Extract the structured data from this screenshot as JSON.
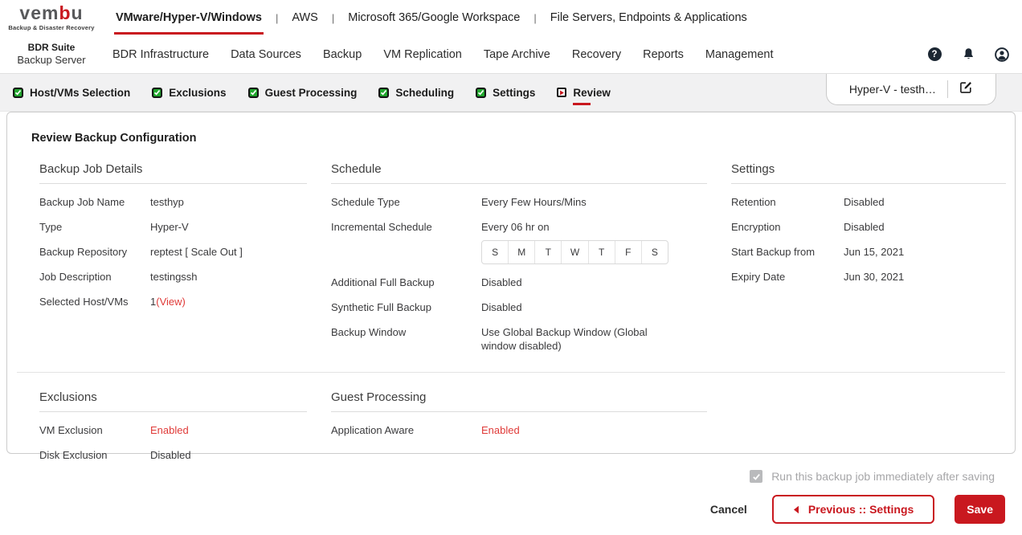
{
  "colors": {
    "brand_red": "#c9181f",
    "status_red": "#e03a38",
    "check_green": "#21a72e"
  },
  "logo": {
    "text_pre": "vem",
    "text_accent": "b",
    "text_post": "u",
    "tagline": "Backup & Disaster Recovery"
  },
  "product": {
    "suite": "BDR Suite",
    "server": "Backup Server"
  },
  "top_nav": {
    "items": [
      {
        "label": "VMware/Hyper-V/Windows",
        "active": true
      },
      {
        "label": "AWS"
      },
      {
        "label": "Microsoft 365/Google Workspace"
      },
      {
        "label": "File Servers, Endpoints & Applications"
      }
    ]
  },
  "main_nav": {
    "items": [
      "BDR Infrastructure",
      "Data Sources",
      "Backup",
      "VM Replication",
      "Tape Archive",
      "Recovery",
      "Reports",
      "Management"
    ]
  },
  "header_icons": {
    "help_glyph": "?"
  },
  "wizard": {
    "completed_steps": [
      "Host/VMs Selection",
      "Exclusions",
      "Guest Processing",
      "Scheduling",
      "Settings"
    ],
    "active_step": "Review",
    "job_tab_label": "Hyper-V - testh…"
  },
  "page_title": "Review Backup Configuration",
  "backup_job_details": {
    "title": "Backup Job Details",
    "rows": [
      {
        "label": "Backup Job Name",
        "value": "testhyp"
      },
      {
        "label": "Type",
        "value": "Hyper-V"
      },
      {
        "label": "Backup Repository",
        "value": "reptest [ Scale Out ]"
      },
      {
        "label": "Job Description",
        "value": "testingssh"
      },
      {
        "label": "Selected Host/VMs",
        "value": "1",
        "link": "(View)"
      }
    ]
  },
  "schedule": {
    "title": "Schedule",
    "schedule_type_label": "Schedule Type",
    "schedule_type": "Every Few Hours/Mins",
    "incremental_label": "Incremental Schedule",
    "incremental": "Every 06 hr on",
    "days": [
      "S",
      "M",
      "T",
      "W",
      "T",
      "F",
      "S"
    ],
    "rows": [
      {
        "label": "Additional Full Backup",
        "value": "Disabled"
      },
      {
        "label": "Synthetic Full Backup",
        "value": "Disabled"
      },
      {
        "label": "Backup Window",
        "value": "Use Global Backup Window  (Global window disabled)"
      }
    ]
  },
  "settings": {
    "title": "Settings",
    "rows": [
      {
        "label": "Retention",
        "value": "Disabled"
      },
      {
        "label": "Encryption",
        "value": "Disabled"
      },
      {
        "label": "Start Backup from",
        "value": "Jun 15, 2021"
      },
      {
        "label": "Expiry Date",
        "value": "Jun 30, 2021"
      }
    ]
  },
  "exclusions": {
    "title": "Exclusions",
    "rows": [
      {
        "label": "VM Exclusion",
        "value": "Enabled"
      },
      {
        "label": "Disk Exclusion",
        "value": "Disabled"
      }
    ]
  },
  "guest_processing": {
    "title": "Guest Processing",
    "rows": [
      {
        "label": "Application Aware",
        "value": "Enabled"
      }
    ]
  },
  "footer": {
    "run_label": "Run this backup job immediately after saving",
    "cancel": "Cancel",
    "previous": "Previous :: Settings",
    "save": "Save"
  }
}
